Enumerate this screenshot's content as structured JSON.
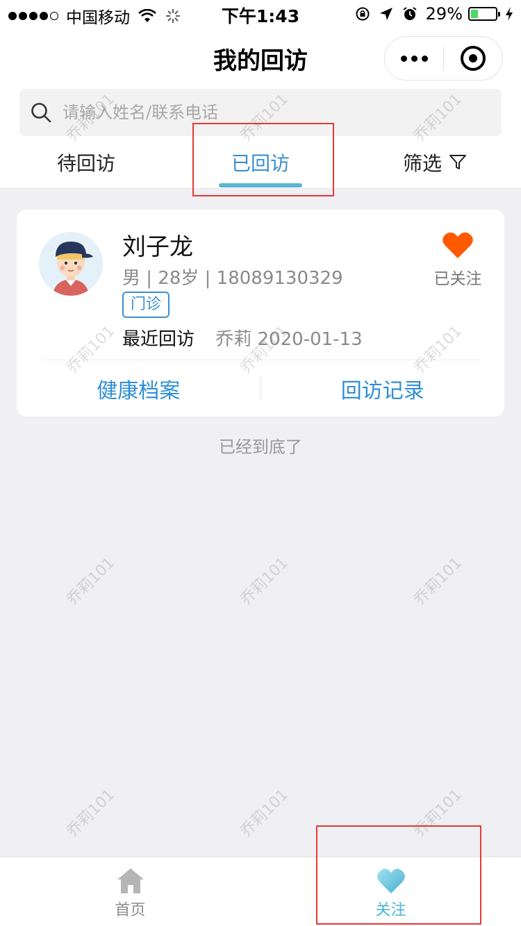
{
  "status_bar": {
    "carrier": "中国移动",
    "time": "下午1:43",
    "battery": "29%",
    "battery_level": 0.29
  },
  "header": {
    "title": "我的回访"
  },
  "search": {
    "placeholder": "请输入姓名/联系电话"
  },
  "tabs": {
    "pending": "待回访",
    "done": "已回访",
    "filter": "筛选"
  },
  "patient_card": {
    "name": "刘子龙",
    "info": "男 | 28岁 | 18089130329",
    "tag": "门诊",
    "last_visit_label": "最近回访",
    "last_visit_value": "乔莉 2020-01-13",
    "follow_status": "已关注",
    "actions": {
      "health_record": "健康档案",
      "visit_record": "回访记录"
    }
  },
  "list_end_text": "已经到底了",
  "watermark_text": "乔莉101",
  "bottom_nav": {
    "home": "首页",
    "follow": "关注"
  },
  "colors": {
    "accent": "#3a8fd0",
    "tab_underline": "#5ab6cf",
    "heart": "#ff5a00",
    "annotation": "#e53935"
  }
}
